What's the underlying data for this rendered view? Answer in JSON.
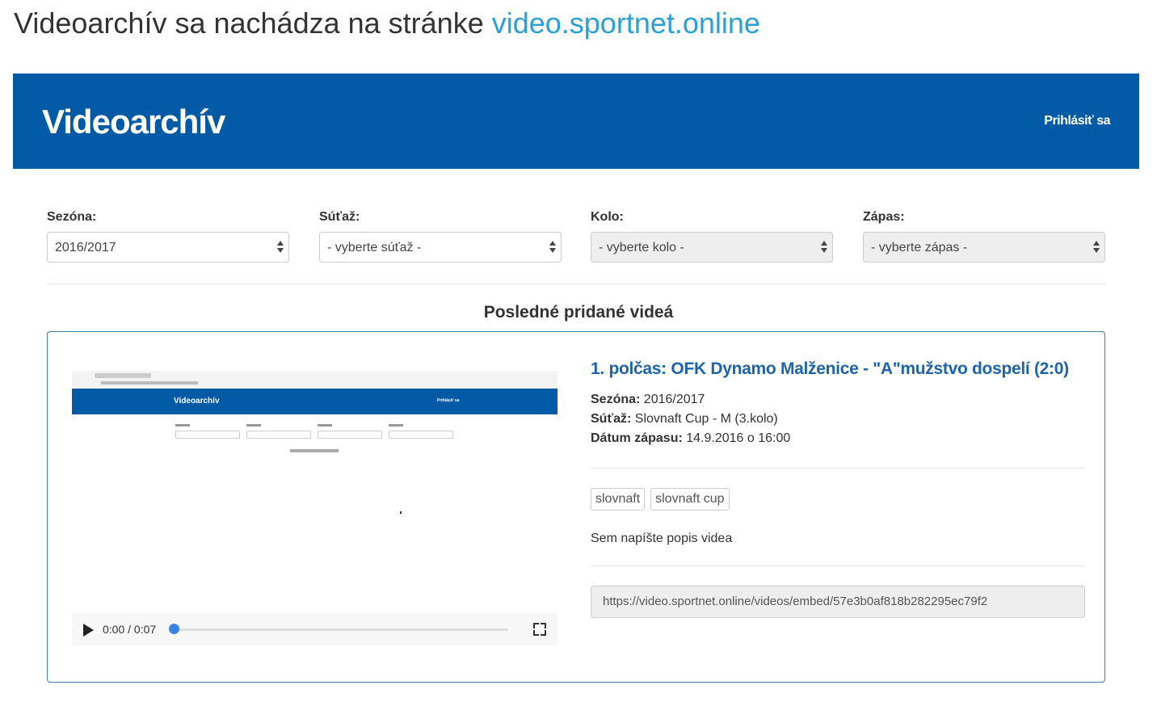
{
  "caption": {
    "text": "Videoarchív sa nachádza na stránke ",
    "link": "video.sportnet.online"
  },
  "navbar": {
    "brand": "Videoarchív",
    "login": "Prihlásiť sa"
  },
  "filters": [
    {
      "label": "Sezóna:",
      "value": "2016/2017",
      "disabled": false
    },
    {
      "label": "Súťaž:",
      "value": "- vyberte súťaž -",
      "disabled": false
    },
    {
      "label": "Kolo:",
      "value": "- vyberte kolo -",
      "disabled": true
    },
    {
      "label": "Zápas:",
      "value": "- vyberte zápas -",
      "disabled": true
    }
  ],
  "section_title": "Posledné pridané videá",
  "video": {
    "title": "1. polčas: OFK Dynamo Malženice - \"A\"mužstvo dospelí (2:0)",
    "season_label": "Sezóna:",
    "season_value": "2016/2017",
    "competition_label": "Súťaž:",
    "competition_value": "Slovnaft Cup - M (3.kolo)",
    "date_label": "Dátum zápasu:",
    "date_value": "14.9.2016 o 16:00",
    "tags": [
      "slovnaft",
      "slovnaft cup"
    ],
    "description": "Sem napíšte popis videa",
    "embed_url": "https://video.sportnet.online/videos/embed/57e3b0af818b282295ec79f2",
    "player": {
      "time": "0:00 / 0:07",
      "progress": 0,
      "thumb_brand": "Videoarchív",
      "thumb_login": "Prihlásiť sa"
    }
  },
  "colors": {
    "navbar": "#005aa6",
    "link": "#2aa0d8",
    "title": "#1d64ad",
    "card_border": "#3c7ebf"
  }
}
